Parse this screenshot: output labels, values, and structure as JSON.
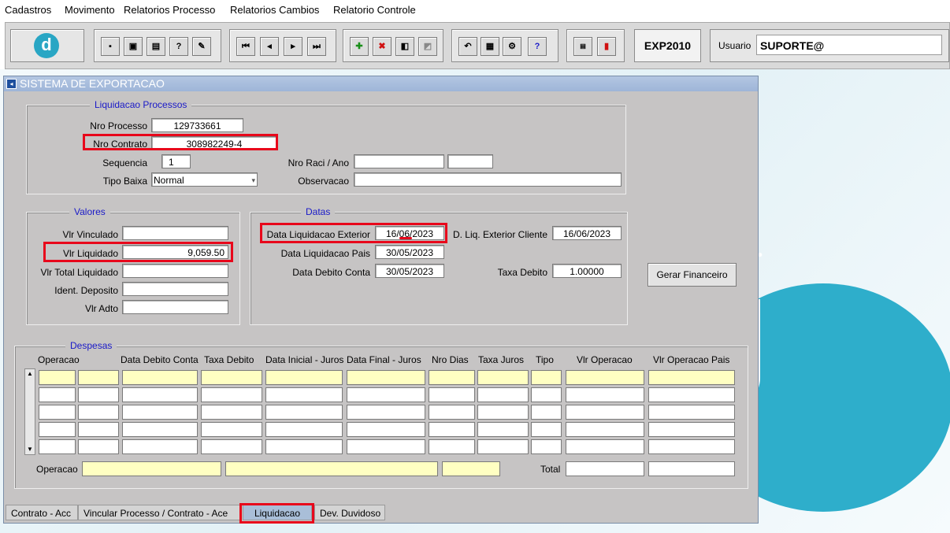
{
  "menu": [
    "Cadastros",
    "Movimento",
    "Relatorios Processo",
    "Relatorios Cambios",
    "Relatorio Controle"
  ],
  "toolbar": {
    "app_code": "EXP2010",
    "user_label": "Usuario",
    "user_value": "SUPORTE@"
  },
  "window": {
    "title": "SISTEMA DE EXPORTACAO"
  },
  "liquidacao": {
    "group_title": "Liquidacao Processos",
    "nro_processo_label": "Nro Processo",
    "nro_processo": "129733661",
    "nro_contrato_label": "Nro Contrato",
    "nro_contrato": "308982249-4",
    "sequencia_label": "Sequencia",
    "sequencia": "1",
    "tipo_baixa_label": "Tipo Baixa",
    "tipo_baixa": "Normal",
    "nro_raci_label": "Nro Raci / Ano",
    "observacao_label": "Observacao"
  },
  "valores": {
    "group_title": "Valores",
    "vlr_vinculado_label": "Vlr Vinculado",
    "vlr_liquidado_label": "Vlr Liquidado",
    "vlr_liquidado": "9,059.50",
    "vlr_total_liquidado_label": "Vlr Total Liquidado",
    "ident_deposito_label": "Ident. Deposito",
    "vlr_adto_label": "Vlr Adto"
  },
  "datas": {
    "group_title": "Datas",
    "data_liq_exterior_label": "Data Liquidacao Exterior",
    "data_liq_exterior": "16/06/2023",
    "d_liq_ext_cliente_label": "D. Liq. Exterior Cliente",
    "d_liq_ext_cliente": "16/06/2023",
    "data_liq_pais_label": "Data Liquidacao Pais",
    "data_liq_pais": "30/05/2023",
    "data_debito_conta_label": "Data Debito Conta",
    "data_debito_conta": "30/05/2023",
    "taxa_debito_label": "Taxa Debito",
    "taxa_debito": "1.00000"
  },
  "gerar_financeiro_label": "Gerar Financeiro",
  "despesas": {
    "group_title": "Despesas",
    "columns": [
      "Operacao",
      "Data Debito Conta",
      "Taxa Debito",
      "Data Inicial - Juros",
      "Data Final - Juros",
      "Nro Dias",
      "Taxa Juros",
      "Tipo",
      "Vlr Operacao",
      "Vlr Operacao Pais"
    ],
    "footer_operacao_label": "Operacao",
    "footer_total_label": "Total"
  },
  "tabs": [
    "Contrato - Acc",
    "Vincular Processo / Contrato - Ace",
    "Liquidacao",
    "Dev. Duvidoso"
  ]
}
